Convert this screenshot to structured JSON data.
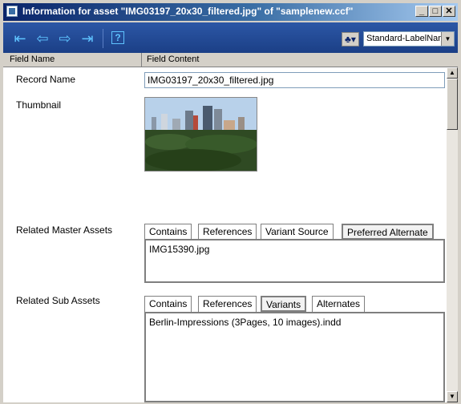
{
  "window": {
    "title": "Information for asset \"IMG03197_20x30_filtered.jpg\" of \"samplenew.ccf\"",
    "controls": {
      "minimize": "_",
      "maximize": "□",
      "close": "✕"
    }
  },
  "toolbar": {
    "nav_icons": [
      "first-record-icon",
      "previous-record-icon",
      "next-record-icon",
      "last-record-icon"
    ],
    "help_glyph": "?",
    "view_select_value": "Standard-LabelName"
  },
  "columns": {
    "field_name": "Field Name",
    "field_content": "Field Content"
  },
  "fields": {
    "record_name_label": "Record Name",
    "record_name_value": "IMG03197_20x30_filtered.jpg",
    "thumbnail_label": "Thumbnail",
    "related_master_label": "Related Master Assets",
    "related_sub_label": "Related Sub Assets"
  },
  "master_tabs": [
    "Contains",
    "References",
    "Variant Source",
    "Preferred Alternate"
  ],
  "master_active_tab": "Preferred Alternate",
  "master_items": [
    "IMG15390.jpg"
  ],
  "sub_tabs": [
    "Contains",
    "References",
    "Variants",
    "Alternates"
  ],
  "sub_active_tab": "Variants",
  "sub_items": [
    "Berlin-Impressions (3Pages, 10 images).indd"
  ]
}
